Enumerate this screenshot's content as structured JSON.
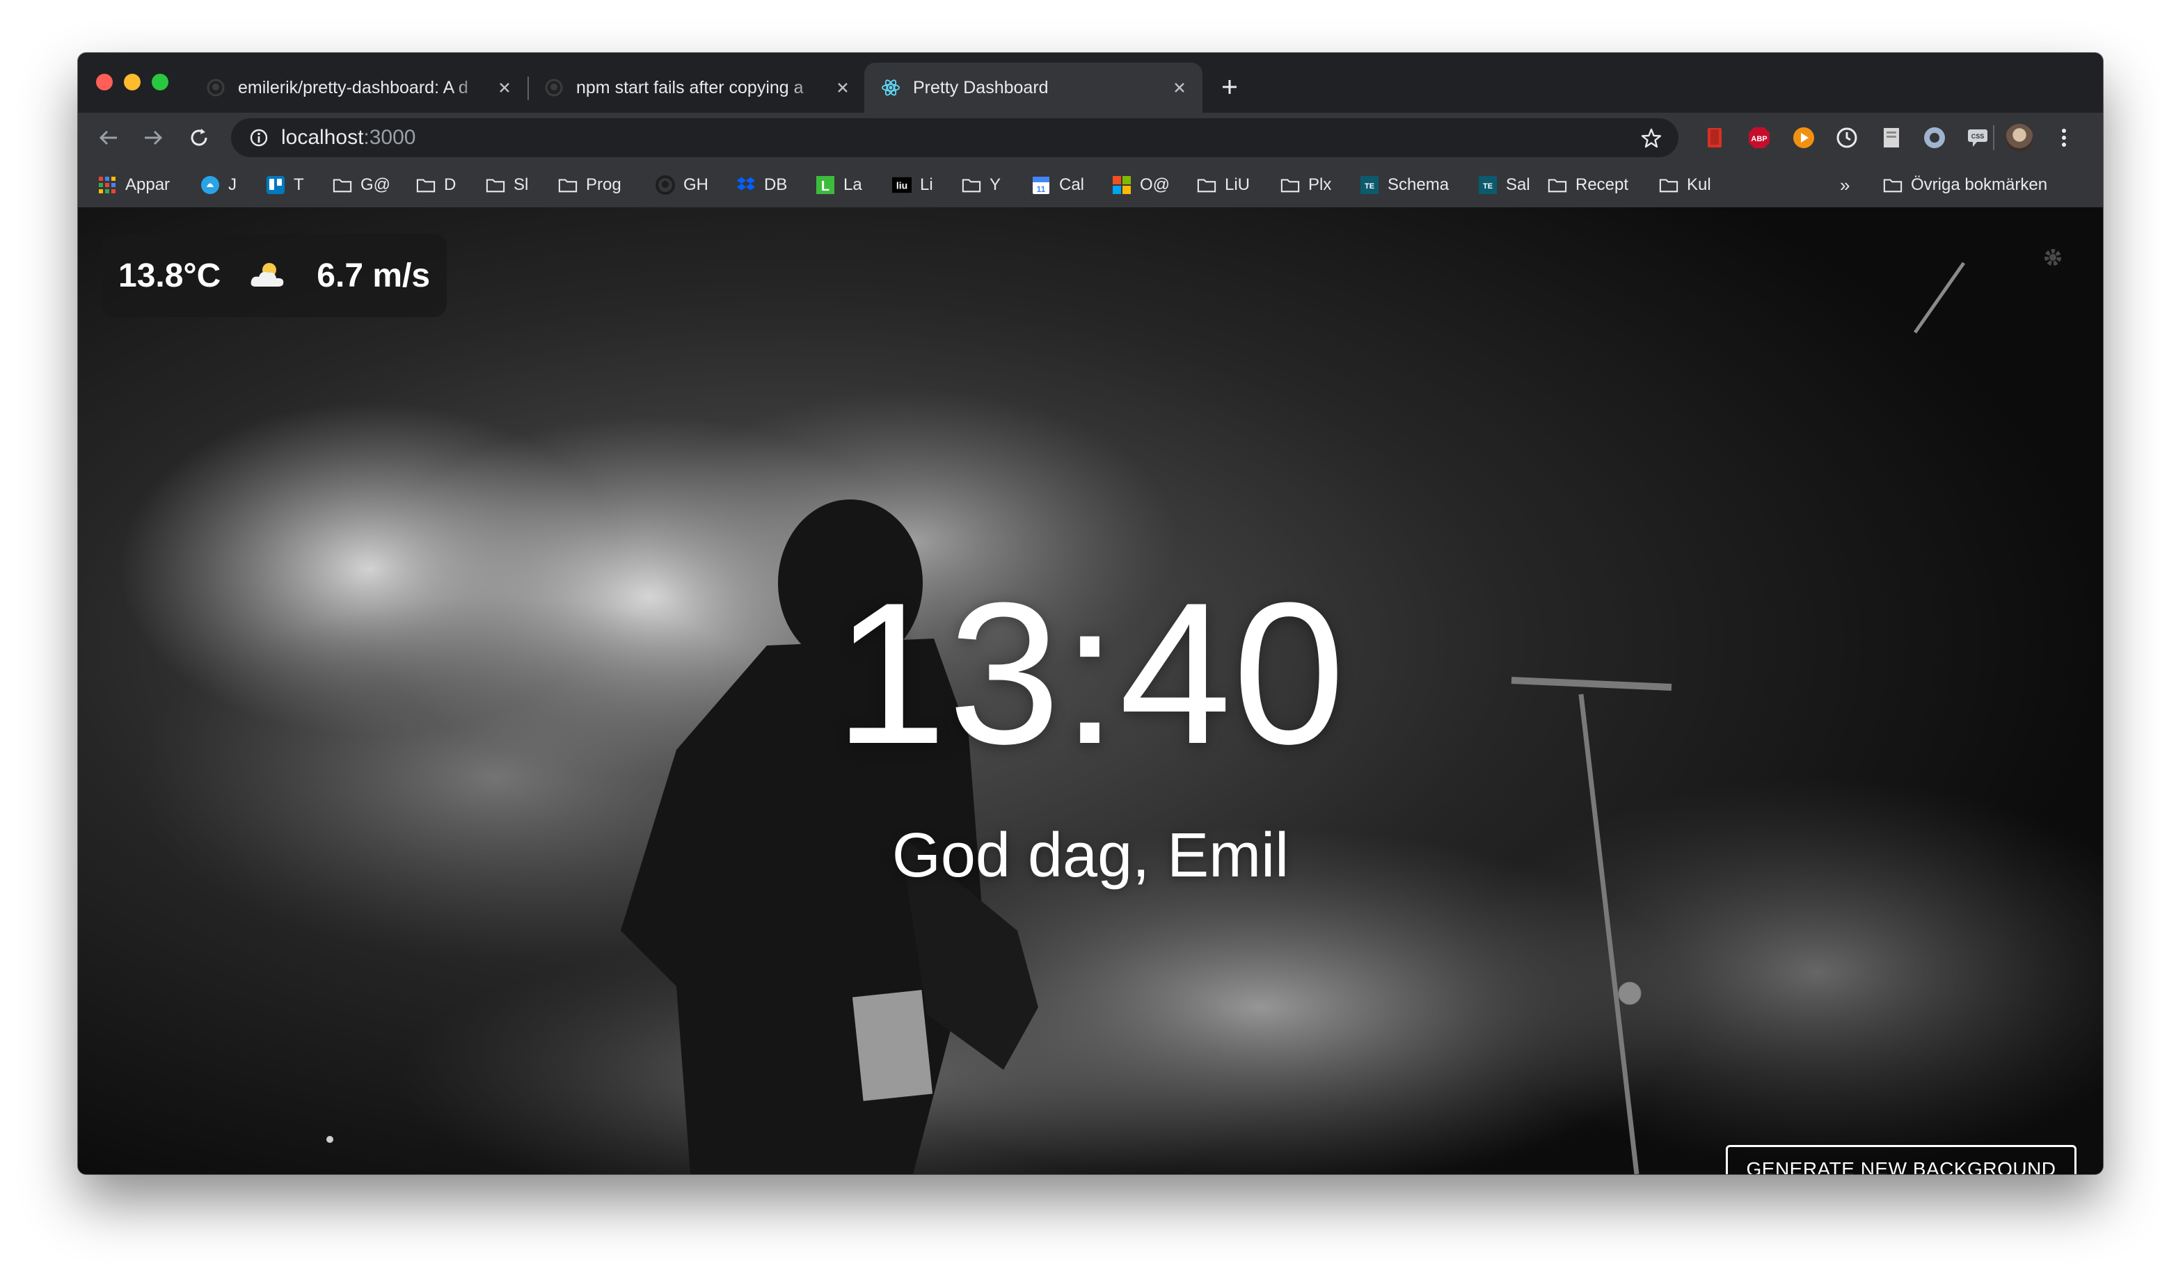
{
  "browser": {
    "tabs": [
      {
        "title": "emilerik/pretty-dashboard: A d",
        "favicon": "github-icon",
        "active": false
      },
      {
        "title": "npm start fails after copying a",
        "favicon": "github-icon",
        "active": false
      },
      {
        "title": "Pretty Dashboard",
        "favicon": "react-icon",
        "active": true
      }
    ],
    "address": {
      "host": "localhost",
      "port": ":3000"
    },
    "extensions": [
      "bookmark-ext-icon",
      "adblock-plus-icon",
      "play-ext-icon",
      "timer-ext-icon",
      "page-ext-icon",
      "circle-ext-icon",
      "css-ext-icon",
      "refresh-ext-icon"
    ],
    "adblock_label": "ABP",
    "css_label": "CSS"
  },
  "bookmarks": [
    {
      "label": "Appar",
      "icon": "apps-grid-icon"
    },
    {
      "label": "J",
      "icon": "blue-circle-icon"
    },
    {
      "label": "T",
      "icon": "trello-icon"
    },
    {
      "label": "G@",
      "icon": "folder-icon"
    },
    {
      "label": "D",
      "icon": "folder-icon"
    },
    {
      "label": "Sl",
      "icon": "folder-icon"
    },
    {
      "label": "Prog",
      "icon": "folder-icon"
    },
    {
      "label": "GH",
      "icon": "github-icon"
    },
    {
      "label": "DB",
      "icon": "dropbox-icon"
    },
    {
      "label": "La",
      "icon": "green-l-icon"
    },
    {
      "label": "Li",
      "icon": "liu-icon"
    },
    {
      "label": "Y",
      "icon": "folder-icon"
    },
    {
      "label": "Cal",
      "icon": "calendar-icon"
    },
    {
      "label": "O@",
      "icon": "microsoft-icon"
    },
    {
      "label": "LiU",
      "icon": "folder-icon"
    },
    {
      "label": "Plx",
      "icon": "folder-icon"
    },
    {
      "label": "Schema",
      "icon": "te-icon"
    },
    {
      "label": "Sal",
      "icon": "te-icon"
    },
    {
      "label": "Recept",
      "icon": "folder-icon"
    },
    {
      "label": "Kul",
      "icon": "folder-icon"
    }
  ],
  "bookmarks_overflow": "»",
  "other_bookmarks": "Övriga bokmärken",
  "calendar_day": "11",
  "te_label": "TE",
  "liu_label": "liu",
  "green_l_label": "L",
  "dashboard": {
    "temperature": "13.8°C",
    "weather_icon": "partly-cloudy-icon",
    "wind": "6.7 m/s",
    "time": "13:40",
    "greeting": "God dag, Emil",
    "generate_button": "GENERATE NEW BACKGROUND"
  },
  "colors": {
    "tabstrip": "#202124",
    "toolbar": "#35363a",
    "text": "#e8eaed",
    "dashboard_text": "#ffffff"
  }
}
